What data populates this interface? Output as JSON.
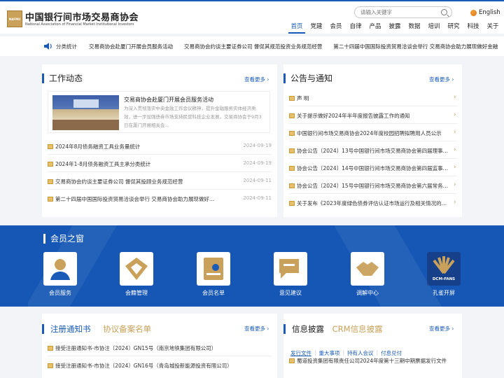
{
  "header": {
    "logo_mark": "NAFMII",
    "org_name_cn": "中国银行间市场交易商协会",
    "org_name_en": "National Association of Financial Market Institutional Investors",
    "search_placeholder": "请输入关键字",
    "lang": "English",
    "nav": [
      "首页",
      "党建",
      "会员",
      "自律",
      "产品",
      "披露",
      "数据",
      "培训",
      "研究",
      "科技",
      "关于"
    ]
  },
  "ticker": {
    "label": "分类统计",
    "items": [
      "交易商协会赴厦门开展会员服务活动",
      "交易商协会约谈主要证券公司 督促其规范投资业务规范经营",
      "第二十四届中国国际投资贸易洽谈会举行 交易商协会助力展现做好金融"
    ]
  },
  "work": {
    "title": "工作动态",
    "more": "查看更多",
    "feature_title": "交易商协会赴厦门开展会员服务活动",
    "feature_desc": "为深入贯彻落实中央金融工作会议精神，提升金融服务实体经济质效，进一步加强债券市场支持民营科技企业发展，交易商协会于9月3日在厦门开展相关会...",
    "items": [
      {
        "t": "2024年8月债务融资工具业务量统计",
        "d": "2024-09-19"
      },
      {
        "t": "2024年1-8月债务融资工具主承分类统计",
        "d": "2024-09-19"
      },
      {
        "t": "交易商协会约谈主要证券公司 督促其投顾业务规范经营",
        "d": "2024-09-11"
      },
      {
        "t": "第二十四届中国国际投资贸易洽谈会举行 交易商协会助力展现做好...",
        "d": "2024-09-11"
      }
    ]
  },
  "notice": {
    "title": "公告与通知",
    "more": "查看更多",
    "items": [
      "声 明",
      "关于提示做好2024年半年度报告披露工作的通知",
      "中国银行间市场交易商协会2024年度校园招聘拟聘用人员公示",
      "协会公告〔2024〕13号中国银行间市场交易商协会第四届理事会...",
      "协会公告〔2024〕14号中国银行间市场交易商协会第四届监事会...",
      "协会公告〔2024〕15号中国银行间市场交易商协会第六届常务理...",
      "关于发布《2023年度绿色债券评估认证市场运行及相关情况的通..."
    ]
  },
  "members": {
    "title": "会员之窗",
    "items": [
      {
        "label": "会员服务",
        "icon": "member-service-icon"
      },
      {
        "label": "会籍管理",
        "icon": "membership-management-icon"
      },
      {
        "label": "会员名单",
        "icon": "member-list-icon"
      },
      {
        "label": "意见建议",
        "icon": "feedback-icon"
      },
      {
        "label": "调解中心",
        "icon": "mediation-icon"
      },
      {
        "label": "孔雀开屏",
        "icon": "dcm-fans-icon",
        "badge": "DCM-FANS"
      }
    ]
  },
  "registration": {
    "tab_active": "注册通知书",
    "tab_other": "协议备案名单",
    "more": "查看更多",
    "items": [
      "接受注册通知书-市协注〔2024〕GN15号（南京地铁集团有限公司）",
      "接受注册通知书-市协注〔2024〕GN16号（青岛城投新能源投资有限公司）"
    ]
  },
  "disclosure": {
    "tab_active": "信息披露",
    "tab_other": "CRM信息披露",
    "more": "查看更多",
    "subtabs": [
      "发行文件",
      "重大事项",
      "持有人会议",
      "付息兑付"
    ],
    "items": [
      "蜀道投资集团有限责任公司2024年度第十三期中期票据发行文件"
    ]
  },
  "colors": {
    "brand": "#1a5bb8",
    "gold": "#c9a15a",
    "band": "#1657b5"
  }
}
